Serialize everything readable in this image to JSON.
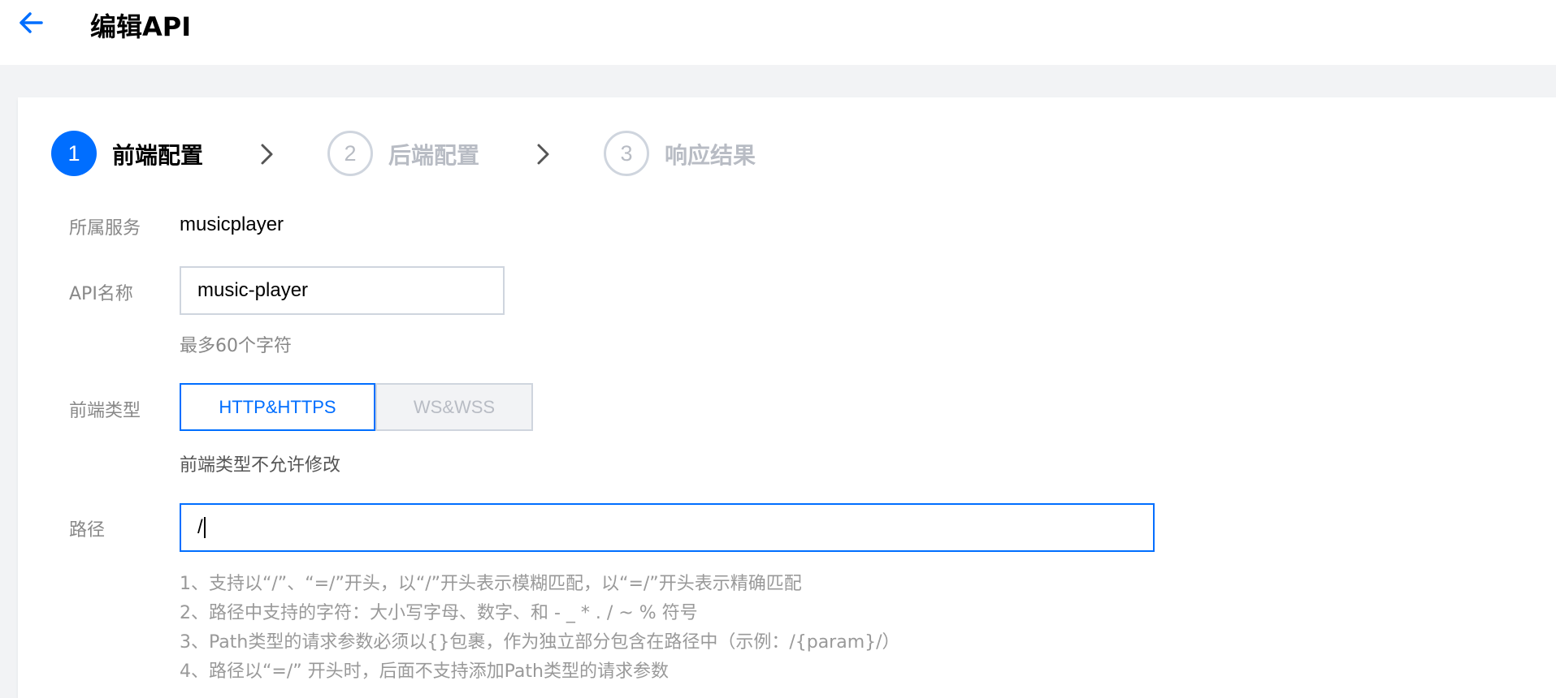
{
  "header": {
    "back_icon": "arrow-left-icon",
    "title": "编辑API"
  },
  "colors": {
    "accent": "#006eff",
    "muted": "#b8bcc4",
    "border": "#cfd5de",
    "page_bg": "#f2f3f5"
  },
  "steps": [
    {
      "number": "1",
      "label": "前端配置",
      "state": "active"
    },
    {
      "number": "2",
      "label": "后端配置",
      "state": "inactive"
    },
    {
      "number": "3",
      "label": "响应结果",
      "state": "inactive"
    }
  ],
  "form": {
    "service": {
      "label": "所属服务",
      "value": "musicplayer"
    },
    "api_name": {
      "label": "API名称",
      "value": "music-player",
      "hint": "最多60个字符"
    },
    "frontend_type": {
      "label": "前端类型",
      "options": [
        "HTTP&HTTPS",
        "WS&WSS"
      ],
      "selected": "HTTP&HTTPS",
      "hint": "前端类型不允许修改"
    },
    "path": {
      "label": "路径",
      "value": "/",
      "rules": [
        "1、支持以“/”、“=/”开头，以“/”开头表示模糊匹配，以“=/”开头表示精确匹配",
        "2、路径中支持的字符：大小写字母、数字、和 - _ * . / ~ % 符号",
        "3、Path类型的请求参数必须以{}包裹，作为独立部分包含在路径中（示例：/{param}/）",
        "4、路径以“=/” 开头时，后面不支持添加Path类型的请求参数"
      ]
    }
  }
}
